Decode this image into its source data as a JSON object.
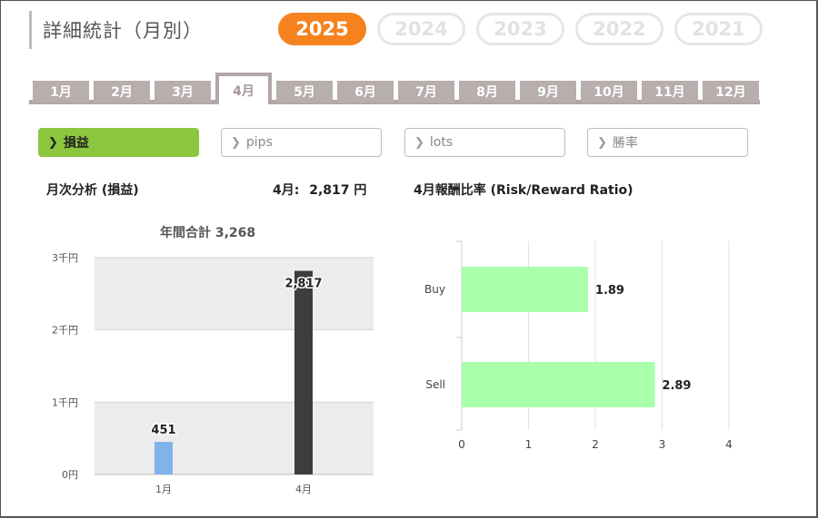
{
  "header": {
    "title": "詳細統計（月別）",
    "years": [
      "2025",
      "2024",
      "2023",
      "2022",
      "2021"
    ],
    "active_year": "2025"
  },
  "months": [
    "1月",
    "2月",
    "3月",
    "4月",
    "5月",
    "6月",
    "7月",
    "8月",
    "9月",
    "10月",
    "11月",
    "12月"
  ],
  "active_month": "4月",
  "metrics": [
    {
      "label": "損益",
      "active": true
    },
    {
      "label": "pips",
      "active": false
    },
    {
      "label": "lots",
      "active": false
    },
    {
      "label": "勝率",
      "active": false
    }
  ],
  "monthly_section": {
    "label": "月次分析 (損益)",
    "month_value_label": "4月:",
    "month_value": "2,817 円"
  },
  "ratio_section": {
    "label": "4月報酬比率 (Risk/Reward Ratio)"
  },
  "colors": {
    "accent": "#f5821f",
    "metric_active": "#8dc63f",
    "bar_jan": "#7eb4e8",
    "bar_apr": "#3d3d3f",
    "ratio_bar": "#aaffaa"
  },
  "chart_data": [
    {
      "type": "bar",
      "title": "年間合計 3,268",
      "categories": [
        "1月",
        "4月"
      ],
      "values": [
        451,
        2817
      ],
      "value_labels": [
        "451",
        "2,817"
      ],
      "ylim": [
        0,
        3000
      ],
      "yticks": [
        0,
        1000,
        2000,
        3000
      ],
      "ytick_labels": [
        "0円",
        "1千円",
        "2千円",
        "3千円"
      ],
      "grid": true
    },
    {
      "type": "bar",
      "orientation": "horizontal",
      "categories": [
        "Buy",
        "Sell"
      ],
      "values": [
        1.89,
        2.89
      ],
      "value_labels": [
        "1.89",
        "2.89"
      ],
      "xlim": [
        0,
        4
      ],
      "xticks": [
        0,
        1,
        2,
        3,
        4
      ],
      "grid": true
    }
  ]
}
